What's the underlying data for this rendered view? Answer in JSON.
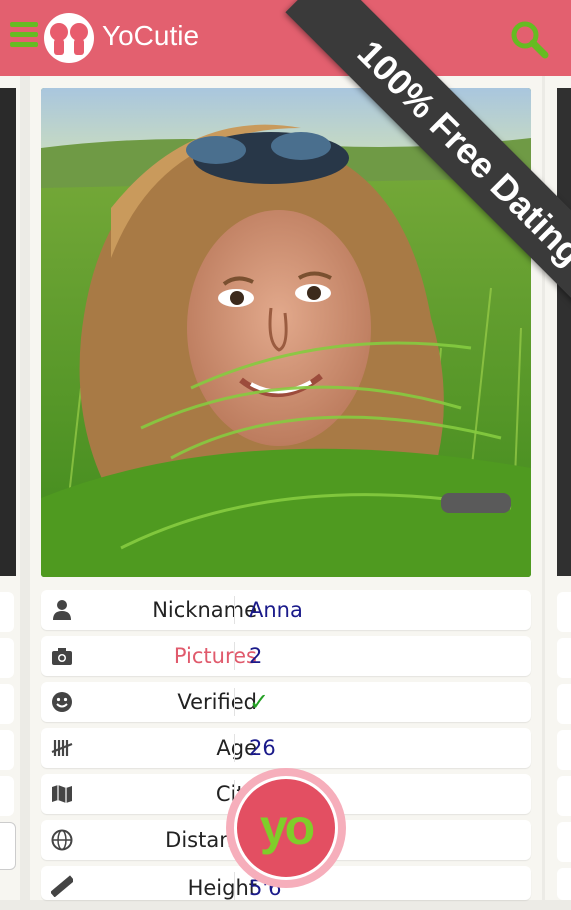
{
  "app": {
    "title": "YoCutie",
    "ribbon": "100% Free Dating",
    "accent": "#e3606f",
    "icon_color": "#66bb22"
  },
  "header": {
    "menu_icon": "hamburger-menu-icon",
    "logo": "couple-logo-icon",
    "search_icon": "search-icon"
  },
  "profile": {
    "rows": [
      {
        "label": "Nickname",
        "value": "Anna",
        "icon": "person-icon"
      },
      {
        "label": "Pictures",
        "value": "2",
        "icon": "camera-icon"
      },
      {
        "label": "Verified",
        "value": "✓",
        "icon": "smiley-icon"
      },
      {
        "label": "Age",
        "value": "26",
        "icon": "tally-icon"
      },
      {
        "label": "City",
        "value": "",
        "icon": "map-icon"
      },
      {
        "label": "Distance",
        "value": "",
        "icon": "globe-icon"
      },
      {
        "label": "Height",
        "value": "5'6",
        "icon": "ruler-icon"
      }
    ]
  },
  "yo_button": {
    "label": "yo"
  }
}
